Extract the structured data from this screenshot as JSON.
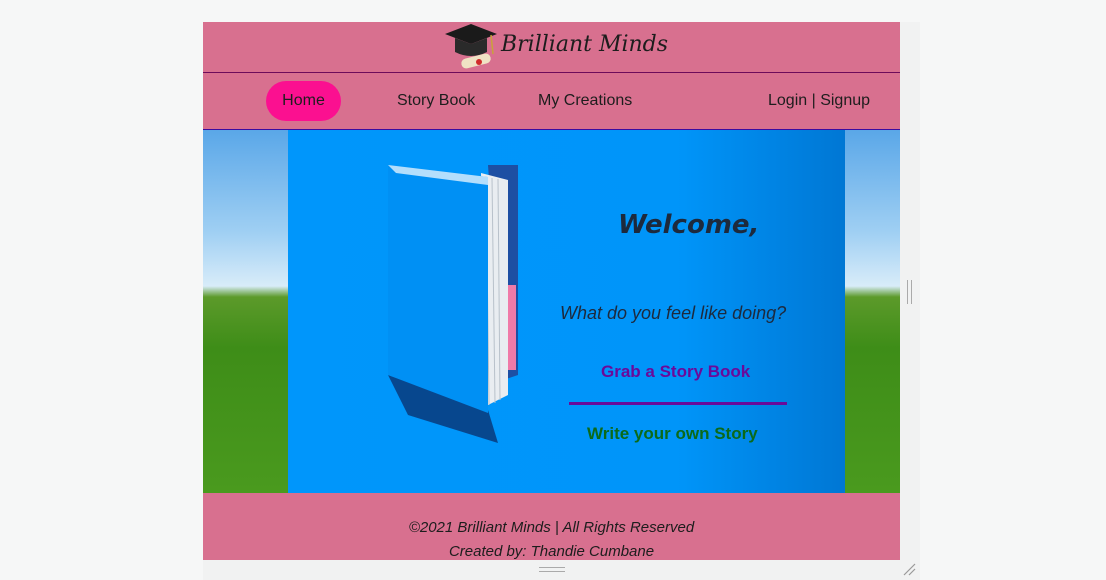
{
  "header": {
    "brand": "Brilliant Minds"
  },
  "nav": {
    "home": "Home",
    "story_book": "Story Book",
    "my_creations": "My Creations",
    "login_signup": "Login | Signup"
  },
  "hero": {
    "welcome": "Welcome,",
    "question": "What do you feel like doing?",
    "grab_link": "Grab a Story Book",
    "write_link": "Write your own Story"
  },
  "footer": {
    "copyright": "©2021 Brilliant Minds | All Rights Reserved",
    "credit": "Created by: Thandie Cumbane"
  },
  "icons": {
    "logo": "graduation-cap-diploma-icon",
    "hero_image": "open-book-icon"
  },
  "colors": {
    "header_bg": "#d8708f",
    "nav_active": "#fb1090",
    "panel_blue": "#0096fb",
    "grab_link": "#6a0a9a",
    "write_link": "#0b6a1a"
  }
}
